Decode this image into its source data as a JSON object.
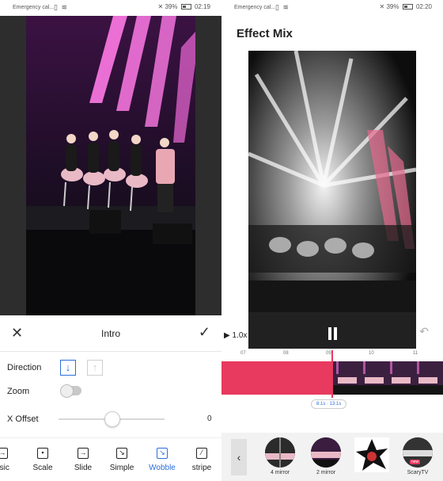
{
  "left": {
    "status": {
      "carrier": "Emergency cal...",
      "battery": "39%",
      "time": "02:19"
    },
    "editor": {
      "title": "Intro",
      "direction_label": "Direction",
      "zoom_label": "Zoom",
      "xoffset_label": "X Offset",
      "xoffset_value": "0"
    },
    "tabs": [
      {
        "label": "asic",
        "icon": "arrow-in-icon",
        "active": false
      },
      {
        "label": "Scale",
        "icon": "scale-icon",
        "active": false
      },
      {
        "label": "Slide",
        "icon": "slide-icon",
        "active": false
      },
      {
        "label": "Simple",
        "icon": "simple-icon",
        "active": false
      },
      {
        "label": "Wobble",
        "icon": "wobble-icon",
        "active": true
      },
      {
        "label": "stripe",
        "icon": "stripe-icon",
        "active": false
      }
    ]
  },
  "right": {
    "status": {
      "carrier": "Emergency cal...",
      "battery": "39%",
      "time": "02:20"
    },
    "title": "Effect Mix",
    "speed": "1.0x",
    "ruler": [
      "07",
      "08",
      "09",
      "10",
      "11"
    ],
    "time_pill": "8.1s · 13.1s",
    "effects": [
      {
        "label": "4 mirror"
      },
      {
        "label": "2 mirror"
      },
      {
        "label": ""
      },
      {
        "label": "ScaryTV",
        "badge": "new"
      }
    ]
  },
  "colors": {
    "accent": "#2b6fdc",
    "timeline_red": "#e8395f"
  }
}
